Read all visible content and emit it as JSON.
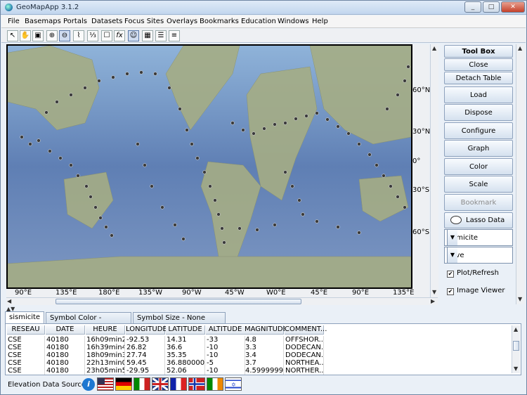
{
  "window": {
    "title": "GeoMapApp 3.1.2",
    "buttons": [
      "_",
      "□",
      "✕"
    ]
  },
  "menu": [
    "File",
    "Basemaps",
    "Portals",
    "Datasets",
    "Focus Sites",
    "Overlays",
    "Bookmarks",
    "Education",
    "Windows",
    "Help"
  ],
  "toolbar": [
    {
      "icon": "pointer-icon",
      "glyph": "↖"
    },
    {
      "icon": "hand-icon",
      "glyph": "✋"
    },
    {
      "icon": "save-icon",
      "glyph": "▣"
    },
    {
      "icon": "zoom-in-icon",
      "glyph": "⊕"
    },
    {
      "icon": "zoom-out-icon",
      "glyph": "⊖"
    },
    {
      "icon": "profile-icon",
      "glyph": "⌇"
    },
    {
      "icon": "ruler-icon",
      "glyph": "⅓"
    },
    {
      "icon": "lasso-icon",
      "glyph": "☐"
    },
    {
      "icon": "function-icon",
      "glyph": "fx"
    },
    {
      "icon": "mask-icon",
      "glyph": "☺"
    },
    {
      "icon": "grid-icon",
      "glyph": "▦"
    },
    {
      "icon": "list-icon",
      "glyph": "☰"
    },
    {
      "icon": "layers-icon",
      "glyph": "≡"
    }
  ],
  "map": {
    "lat_labels": [
      "60°N",
      "30°N",
      "0°",
      "30°S",
      "60°S"
    ],
    "lon_labels": [
      "90°E",
      "135°E",
      "180°E",
      "135°W",
      "90°W",
      "45°W",
      "W0°E",
      "45°E",
      "90°E",
      "135°E"
    ]
  },
  "toolbox": {
    "title": "Tool Box",
    "close": "Close",
    "detach": "Detach Table",
    "buttons": [
      "Load",
      "Dispose",
      "Configure",
      "Graph",
      "Color",
      "Scale",
      "Bookmark"
    ],
    "lasso": "Lasso Data",
    "dataset_combo": "sismicite",
    "save_combo": "Save",
    "plot_refresh": "Plot/Refresh",
    "image_viewer": "Image Viewer"
  },
  "tabs": [
    "sismicite",
    "Symbol Color - ALTITUDE",
    "Symbol Size - None Selected"
  ],
  "table": {
    "columns": [
      "RESEAU",
      "DATE",
      "HEURE",
      "LONGITUDE",
      "LATITUDE",
      "ALTITUDE",
      "MAGNITUDE",
      "COMMENT..."
    ],
    "rows": [
      [
        "CSE",
        "40180",
        "16h09min2...",
        "-92.53",
        "14.31",
        "-33",
        "4.8",
        "OFFSHOR..."
      ],
      [
        "CSE",
        "40180",
        "16h39min4...",
        "26.82",
        "36.6",
        "-10",
        "3.3",
        "DODECAN..."
      ],
      [
        "CSE",
        "40180",
        "18h09min3...",
        "27.74",
        "35.35",
        "-10",
        "3.4",
        "DODECAN..."
      ],
      [
        "CSE",
        "40180",
        "22h13min0...",
        "59.45",
        "36.880000...",
        "-5",
        "3.7",
        "NORTHEA..."
      ],
      [
        "CSE",
        "40180",
        "23h05min5...",
        "-29.95",
        "52.06",
        "-10",
        "4.5999999",
        "NORTHER..."
      ]
    ]
  },
  "footer": {
    "label": "Elevation Data Sources",
    "flags": [
      "us-flag-icon",
      "germany-flag-icon",
      "italy-flag-icon",
      "uk-flag-icon",
      "france-flag-icon",
      "norway-flag-icon",
      "ireland-flag-icon",
      "israel-flag-icon"
    ]
  }
}
